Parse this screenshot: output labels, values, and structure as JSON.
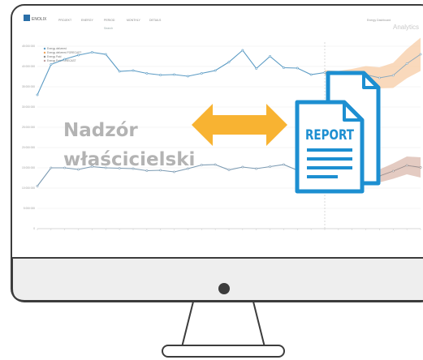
{
  "app": {
    "logo": "ENOLIX",
    "brand": "Analytics",
    "user_label": "Energy Dashboard",
    "toolbar_items": [
      "PROJEKT",
      "ENERGY",
      "PERIOD",
      "MONTHLY",
      "DETAILS"
    ],
    "search_label": "Search"
  },
  "overlay": {
    "line1": "Nadzór",
    "line2": "właścicielski",
    "report_label": "REPORT"
  },
  "colors": {
    "screen_bezel": "#f0f0f0",
    "outline": "#3c3c3c",
    "arrow": "#f8b332",
    "document": "#1d8fd1",
    "series_top": "#5b9bc4",
    "series_bottom": "#5b9bc4",
    "forecast_band": "#f6c9a0",
    "forecast_band_low": "#d9b5a8"
  },
  "chart_data": {
    "type": "line",
    "legend": [
      "Energy delivered",
      "Energy delivered FORECAST",
      "Energy Paid",
      "Energy Paid FORECAST"
    ],
    "y_ticks": [
      "45 000 000",
      "40 000 000",
      "35 000 000",
      "30 000 000",
      "25 000 000",
      "20 000 000",
      "15 000 000",
      "10 000 000",
      "5 000 000",
      "0"
    ],
    "ylim": [
      0,
      46000000
    ],
    "series": [
      {
        "name": "Energy delivered",
        "values": [
          33000000,
          40500000,
          41800000,
          42800000,
          43500000,
          43000000,
          38800000,
          39000000,
          38300000,
          37900000,
          38000000,
          37600000,
          38300000,
          39000000,
          41100000,
          44000000,
          39500000,
          42500000,
          39700000,
          39600000,
          38000000,
          38500000
        ]
      },
      {
        "name": "Energy delivered FORECAST",
        "values": [
          null,
          null,
          null,
          null,
          null,
          null,
          null,
          null,
          null,
          null,
          null,
          null,
          null,
          null,
          null,
          null,
          null,
          null,
          null,
          null,
          null,
          38500000,
          37800000,
          37800000,
          38000000,
          37200000,
          37800000,
          40700000,
          43000000
        ]
      },
      {
        "name": "Energy Paid",
        "values": [
          10500000,
          15000000,
          15000000,
          14600000,
          15300000,
          15000000,
          14900000,
          14800000,
          14300000,
          14400000,
          14000000,
          14800000,
          15700000,
          15800000,
          14500000,
          15200000,
          14800000,
          15300000,
          15800000,
          14400000,
          14500000,
          13800000
        ]
      },
      {
        "name": "Energy Paid FORECAST",
        "values": [
          null,
          null,
          null,
          null,
          null,
          null,
          null,
          null,
          null,
          null,
          null,
          null,
          null,
          null,
          null,
          null,
          null,
          null,
          null,
          null,
          null,
          13800000,
          13200000,
          12800000,
          12600000,
          13000000,
          14200000,
          15600000,
          15100000
        ]
      }
    ]
  }
}
